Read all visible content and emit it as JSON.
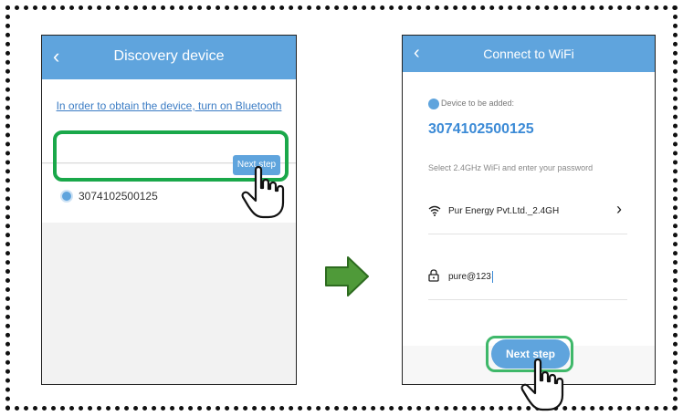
{
  "left_screen": {
    "back_icon": "chevron-left-icon",
    "title": "Discovery device",
    "hint": "In order to obtain the device, turn on Bluetooth",
    "device_id": "3074102500125",
    "next_button": "Next step"
  },
  "right_screen": {
    "back_icon": "chevron-left-icon",
    "title": "Connect to WiFi",
    "device_label": "Device to be added:",
    "device_id": "3074102500125",
    "instruction": "Select 2.4GHz WiFi and enter your password",
    "wifi_name": "Pur Energy Pvt.Ltd._2.4GH",
    "password": "pure@123",
    "next_button": "Next step"
  },
  "colors": {
    "header": "#5fa4dd",
    "highlight": "#1aa84a",
    "arrow": "#4f9a39",
    "device_id": "#3b8ad6"
  },
  "icons": [
    "chevron-left-icon",
    "device-dot-icon",
    "wifi-icon",
    "lock-icon",
    "chevron-right-icon",
    "pointing-hand-icon",
    "arrow-right-icon"
  ]
}
